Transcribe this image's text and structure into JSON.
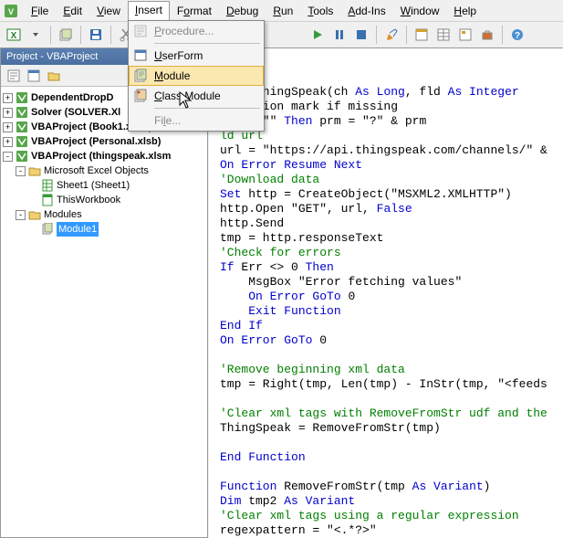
{
  "menubar": {
    "items": [
      {
        "label": "File",
        "hotkey": "F"
      },
      {
        "label": "Edit",
        "hotkey": "E"
      },
      {
        "label": "View",
        "hotkey": "V"
      },
      {
        "label": "Insert",
        "hotkey": "I"
      },
      {
        "label": "Format",
        "hotkey": "o"
      },
      {
        "label": "Debug",
        "hotkey": "D"
      },
      {
        "label": "Run",
        "hotkey": "R"
      },
      {
        "label": "Tools",
        "hotkey": "T"
      },
      {
        "label": "Add-Ins",
        "hotkey": "A"
      },
      {
        "label": "Window",
        "hotkey": "W"
      },
      {
        "label": "Help",
        "hotkey": "H"
      }
    ]
  },
  "dropdown": {
    "items": [
      {
        "label": "Procedure...",
        "hotkey": "P",
        "enabled": false,
        "icon": "procedure"
      },
      {
        "label": "UserForm",
        "hotkey": "U",
        "enabled": true,
        "icon": "userform"
      },
      {
        "label": "Module",
        "hotkey": "M",
        "enabled": true,
        "icon": "module",
        "hover": true
      },
      {
        "label": "Class Module",
        "hotkey": "C",
        "enabled": true,
        "icon": "classmodule"
      },
      {
        "label": "File...",
        "hotkey": "l",
        "enabled": false,
        "icon": ""
      }
    ]
  },
  "project": {
    "title": "Project - VBAProject",
    "tree": [
      {
        "depth": 0,
        "twist": "+",
        "icon": "vba",
        "label": "DependentDropD",
        "bold": true
      },
      {
        "depth": 0,
        "twist": "+",
        "icon": "vba",
        "label": "Solver (SOLVER.Xl",
        "bold": true
      },
      {
        "depth": 0,
        "twist": "+",
        "icon": "vba",
        "label": "VBAProject (Book1.xlsm)",
        "bold": true
      },
      {
        "depth": 0,
        "twist": "+",
        "icon": "vba",
        "label": "VBAProject (Personal.xlsb)",
        "bold": true
      },
      {
        "depth": 0,
        "twist": "-",
        "icon": "vba",
        "label": "VBAProject (thingspeak.xlsm",
        "bold": true
      },
      {
        "depth": 1,
        "twist": "-",
        "icon": "folder",
        "label": "Microsoft Excel Objects",
        "bold": false
      },
      {
        "depth": 2,
        "twist": "",
        "icon": "sheet",
        "label": "Sheet1 (Sheet1)",
        "bold": false
      },
      {
        "depth": 2,
        "twist": "",
        "icon": "book",
        "label": "ThisWorkbook",
        "bold": false
      },
      {
        "depth": 1,
        "twist": "-",
        "icon": "folder",
        "label": "Modules",
        "bold": false
      },
      {
        "depth": 2,
        "twist": "",
        "icon": "module",
        "label": "Module1",
        "bold": false,
        "selected": true
      }
    ]
  },
  "code": {
    "lines": [
      {
        "t": "tion ThingSpeak(ch ",
        "p": [
          {
            "c": "kw",
            "t": "As Long"
          },
          {
            "c": "",
            "t": ", fld "
          },
          {
            "c": "kw",
            "t": "As Integer"
          }
        ]
      },
      {
        "t": " question mark if missing",
        "pre": {
          "c": "cm",
          "t": ""
        }
      },
      {
        "t": "rm <> \"\" ",
        "p": [
          {
            "c": "kw",
            "t": "Then"
          },
          {
            "c": "",
            "t": " prm = \"?\" & prm"
          }
        ]
      },
      {
        "t": "",
        "p": [
          {
            "c": "cm",
            "t": "ld url"
          }
        ]
      },
      {
        "t": "url = \"https://api.thingspeak.com/channels/\" & "
      },
      {
        "t": "",
        "p": [
          {
            "c": "kw",
            "t": "On Error Resume Next"
          }
        ]
      },
      {
        "t": "",
        "p": [
          {
            "c": "cm",
            "t": "'Download data"
          }
        ]
      },
      {
        "t": "",
        "p": [
          {
            "c": "kw",
            "t": "Set"
          },
          {
            "c": "",
            "t": " http = CreateObject(\"MSXML2.XMLHTTP\")"
          }
        ]
      },
      {
        "t": "http.Open \"GET\", url, ",
        "p": [
          {
            "c": "kw",
            "t": "False"
          }
        ]
      },
      {
        "t": "http.Send"
      },
      {
        "t": "tmp = http.responseText"
      },
      {
        "t": "",
        "p": [
          {
            "c": "cm",
            "t": "'Check for errors"
          }
        ]
      },
      {
        "t": "",
        "p": [
          {
            "c": "kw",
            "t": "If"
          },
          {
            "c": "",
            "t": " Err <> 0 "
          },
          {
            "c": "kw",
            "t": "Then"
          }
        ]
      },
      {
        "t": "    MsgBox \"Error fetching values\""
      },
      {
        "t": "    ",
        "p": [
          {
            "c": "kw",
            "t": "On Error GoTo"
          },
          {
            "c": "",
            "t": " 0"
          }
        ]
      },
      {
        "t": "    ",
        "p": [
          {
            "c": "kw",
            "t": "Exit Function"
          }
        ]
      },
      {
        "t": "",
        "p": [
          {
            "c": "kw",
            "t": "End If"
          }
        ]
      },
      {
        "t": "",
        "p": [
          {
            "c": "kw",
            "t": "On Error GoTo"
          },
          {
            "c": "",
            "t": " 0"
          }
        ]
      },
      {
        "t": ""
      },
      {
        "t": "",
        "p": [
          {
            "c": "cm",
            "t": "'Remove beginning xml data"
          }
        ]
      },
      {
        "t": "tmp = Right(tmp, Len(tmp) - InStr(tmp, \"<feeds"
      }
    ],
    "lines2": [
      {
        "t": "",
        "p": [
          {
            "c": "cm",
            "t": "'Clear xml tags with RemoveFromStr udf and the"
          }
        ]
      },
      {
        "t": "ThingSpeak = RemoveFromStr(tmp)"
      },
      {
        "t": ""
      },
      {
        "t": "",
        "p": [
          {
            "c": "kw",
            "t": "End Function"
          }
        ]
      },
      {
        "t": ""
      },
      {
        "t": "",
        "p": [
          {
            "c": "kw",
            "t": "Function"
          },
          {
            "c": "",
            "t": " RemoveFromStr(tmp "
          },
          {
            "c": "kw",
            "t": "As Variant"
          },
          {
            "c": "",
            "t": ")"
          }
        ]
      },
      {
        "t": "",
        "p": [
          {
            "c": "kw",
            "t": "Dim"
          },
          {
            "c": "",
            "t": " tmp2 "
          },
          {
            "c": "kw",
            "t": "As Variant"
          }
        ]
      },
      {
        "t": "",
        "p": [
          {
            "c": "cm",
            "t": "'Clear xml tags using a regular expression"
          }
        ]
      },
      {
        "t": "regexpattern = \"<.*?>\""
      }
    ]
  }
}
